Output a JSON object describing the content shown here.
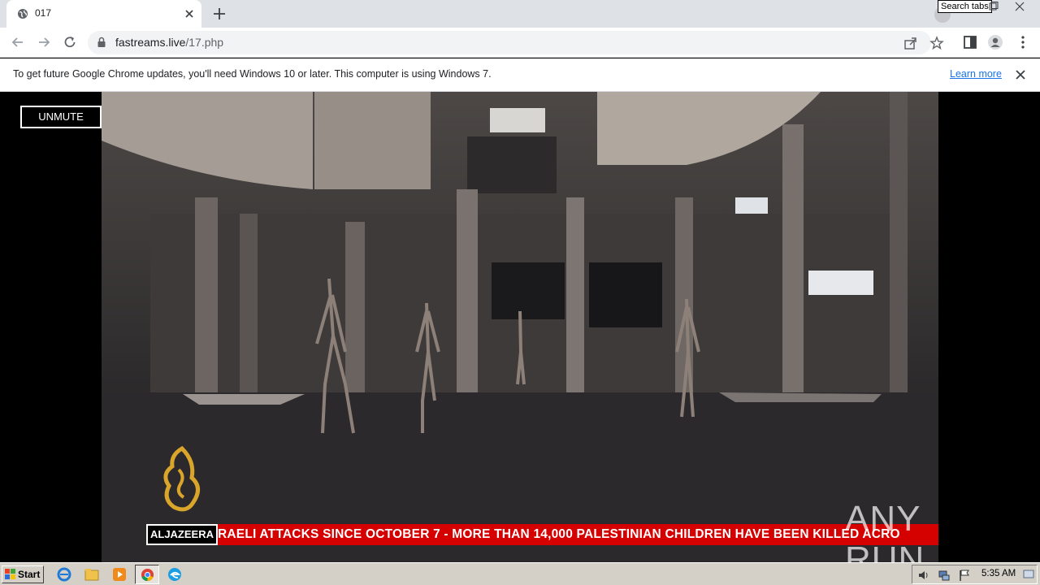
{
  "browser": {
    "tab": {
      "title": "017"
    },
    "tooltip": "Search tabs",
    "url": {
      "host": "fastreams.live",
      "path": "/17.php"
    },
    "infobar": {
      "message": "To get future Google Chrome updates, you'll need Windows 10 or later. This computer is using Windows 7.",
      "link": "Learn more"
    }
  },
  "page": {
    "unmute_label": "UNMUTE",
    "broadcast": {
      "channel_label": "ALJAZEERA",
      "ticker": "RAELI ATTACKS SINCE OCTOBER 7   -   MORE THAN 14,000 PALESTINIAN CHILDREN HAVE BEEN KILLED ACRO"
    },
    "watermark": "ANY RUN"
  },
  "taskbar": {
    "start_label": "Start",
    "clock": "5:35 AM"
  },
  "colors": {
    "ticker_red": "#d50000",
    "chrome_blue": "#1a73e8",
    "taskbar": "#d4d0c8"
  }
}
